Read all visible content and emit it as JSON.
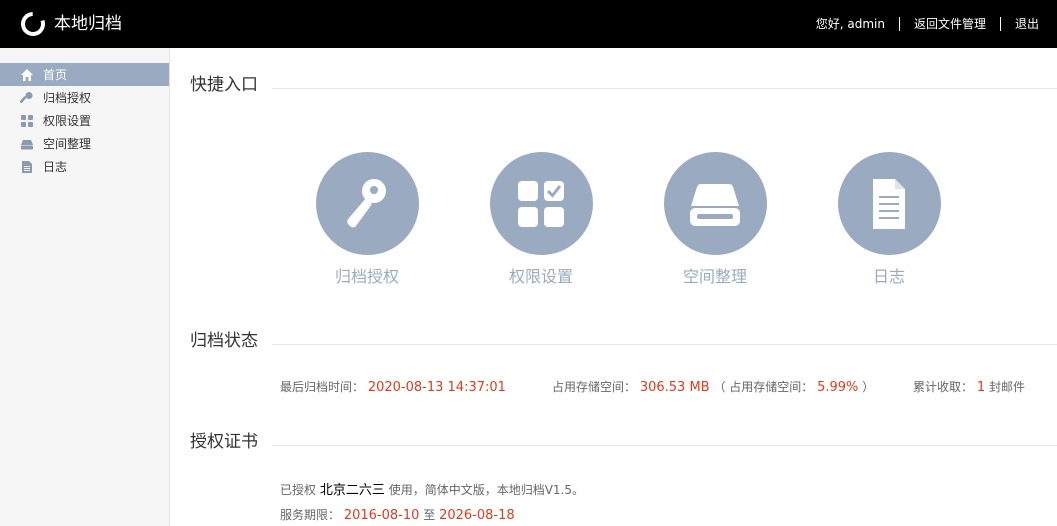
{
  "header": {
    "app_title": "本地归档",
    "greeting": "您好, admin",
    "nav_back": "返回文件管理",
    "nav_logout": "退出"
  },
  "sidebar": {
    "items": [
      {
        "label": "首页",
        "icon": "home-icon",
        "active": true
      },
      {
        "label": "归档授权",
        "icon": "key-icon",
        "active": false
      },
      {
        "label": "权限设置",
        "icon": "grid-icon",
        "active": false
      },
      {
        "label": "空间整理",
        "icon": "drive-icon",
        "active": false
      },
      {
        "label": "日志",
        "icon": "document-icon",
        "active": false
      }
    ]
  },
  "quick_entry": {
    "title": "快捷入口",
    "items": [
      {
        "label": "归档授权",
        "icon": "key-icon"
      },
      {
        "label": "权限设置",
        "icon": "grid-check-icon"
      },
      {
        "label": "空间整理",
        "icon": "drive-icon"
      },
      {
        "label": "日志",
        "icon": "document-icon"
      }
    ]
  },
  "archive_status": {
    "title": "归档状态",
    "last_time_label": "最后归档时间：",
    "last_time_value": "2020-08-13 14:37:01",
    "storage_label": "占用存储空间：",
    "storage_value": "306.53 MB",
    "storage_pct_prefix": "（ 占用存储空间：",
    "storage_pct_value": "5.99%",
    "storage_pct_suffix": "）",
    "received_label": "累计收取：",
    "received_value": "1",
    "received_unit": "封邮件"
  },
  "license": {
    "title": "授权证书",
    "licensed_prefix": "已授权",
    "licensee": "北京二六三",
    "licensed_suffix": "使用，简体中文版，本地归档V1.5。",
    "period_label": "服务期限：",
    "period_start": "2016-08-10",
    "period_to": "至",
    "period_end": "2026-08-18"
  },
  "colors": {
    "accent": "#9aabc1",
    "value_red": "#e4391b",
    "topbar": "#000000"
  }
}
